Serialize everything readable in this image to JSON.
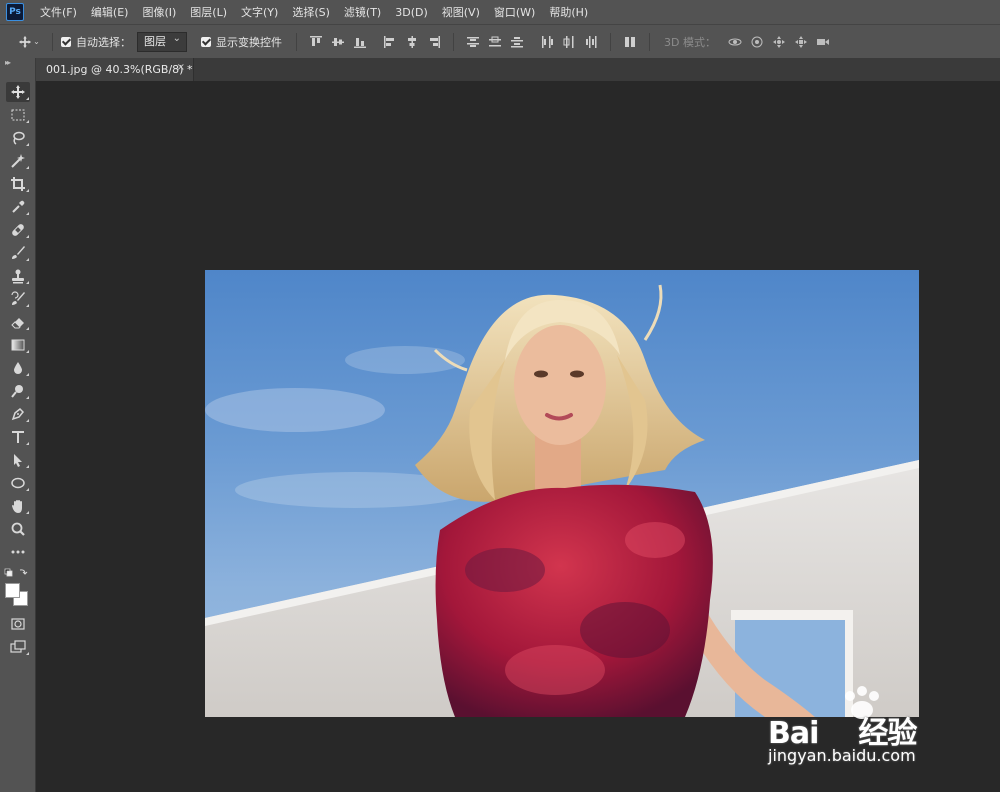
{
  "app": {
    "logo": "Ps"
  },
  "menu": [
    "文件(F)",
    "编辑(E)",
    "图像(I)",
    "图层(L)",
    "文字(Y)",
    "选择(S)",
    "滤镜(T)",
    "3D(D)",
    "视图(V)",
    "窗口(W)",
    "帮助(H)"
  ],
  "options": {
    "auto_select_label": "自动选择：",
    "auto_select_value": "图层",
    "show_transform_label": "显示变换控件",
    "mode3d_label": "3D 模式："
  },
  "document": {
    "tab_label": "001.jpg @ 40.3%(RGB/8) *",
    "close_glyph": "×"
  },
  "colors": {
    "foreground": "#ffffff",
    "background": "#ffffff"
  },
  "tools": [
    "move-tool",
    "marquee-tool",
    "lasso-tool",
    "magic-wand-tool",
    "crop-tool",
    "eyedropper-tool",
    "healing-brush-tool",
    "brush-tool",
    "clone-stamp-tool",
    "history-brush-tool",
    "eraser-tool",
    "gradient-tool",
    "blur-tool",
    "dodge-tool",
    "pen-tool",
    "type-tool",
    "path-selection-tool",
    "ellipse-tool",
    "hand-tool",
    "zoom-tool",
    "more-tools"
  ],
  "watermark": {
    "brand_left": "Bai",
    "brand_right": "经验",
    "url": "jingyan.baidu.com"
  }
}
